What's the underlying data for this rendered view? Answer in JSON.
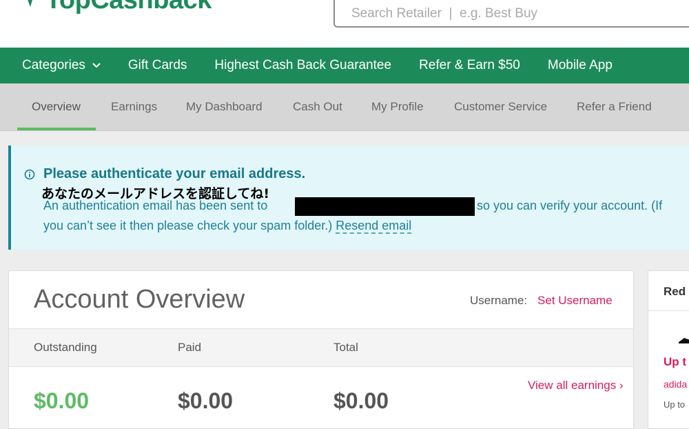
{
  "brand": {
    "logo_text": "TopCashback",
    "color": "#1d8a5a"
  },
  "search": {
    "placeholder": "Search Retailer  |  e.g. Best Buy"
  },
  "nav": {
    "items": [
      {
        "label": "Categories",
        "has_dropdown": true,
        "icon": "chevron-down-icon"
      },
      {
        "label": "Gift Cards"
      },
      {
        "label": "Highest Cash Back Guarantee"
      },
      {
        "label": "Refer & Earn $50"
      },
      {
        "label": "Mobile App"
      }
    ]
  },
  "subnav": {
    "items": [
      {
        "label": "Overview",
        "active": true
      },
      {
        "label": "Earnings"
      },
      {
        "label": "My Dashboard"
      },
      {
        "label": "Cash Out"
      },
      {
        "label": "My Profile"
      },
      {
        "label": "Customer Service"
      },
      {
        "label": "Refer a Friend"
      }
    ],
    "active_color": "#5dbb63"
  },
  "alert": {
    "icon": "info-icon",
    "title": "Please authenticate your email address.",
    "annotation_jp": "あなたのメールアドレスを認証してね!",
    "message_before": "An authentication email has been sent to",
    "message_after": "so you can verify your account. (If",
    "message_line2": "you can’t see it then please check your spam folder.)",
    "resend_label": "Resend email"
  },
  "overview": {
    "title": "Account Overview",
    "username_label": "Username:",
    "username_link": "Set Username",
    "columns": [
      {
        "label": "Outstanding",
        "amount": "$0.00"
      },
      {
        "label": "Paid",
        "amount": "$0.00"
      },
      {
        "label": "Total",
        "amount": "$0.00"
      }
    ],
    "view_all_label": "View all earnings ›",
    "accent": "#d81b60",
    "green": "#5dbb63"
  },
  "side_panel": {
    "heading": "Red",
    "offer_title": "Up t",
    "brand": "adida",
    "sub": "Up to"
  }
}
